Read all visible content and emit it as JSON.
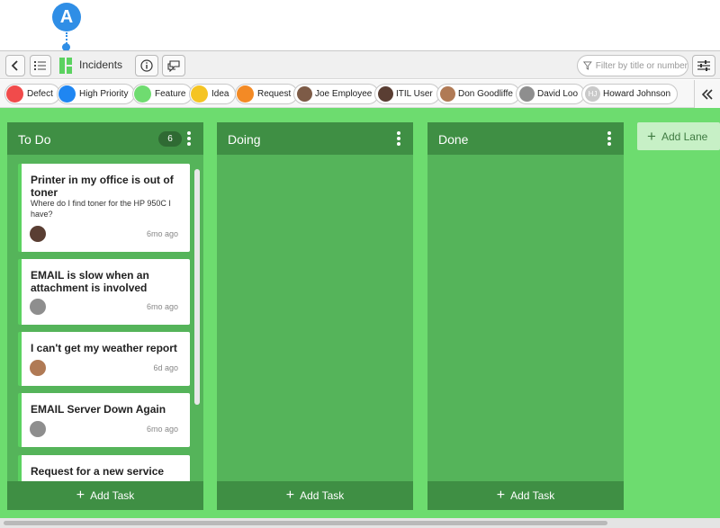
{
  "callout": {
    "label": "A"
  },
  "toolbar": {
    "title": "Incidents",
    "filter_placeholder": "Filter by title or number"
  },
  "tags": [
    {
      "label": "Defect",
      "color": "#f14b4b"
    },
    {
      "label": "High Priority",
      "color": "#1f86f2"
    },
    {
      "label": "Feature",
      "color": "#6fdc70"
    },
    {
      "label": "Idea",
      "color": "#f5c423"
    },
    {
      "label": "Request",
      "color": "#f38a25"
    }
  ],
  "people": [
    {
      "label": "Joe Employee"
    },
    {
      "label": "ITIL User"
    },
    {
      "label": "Don Goodliffe"
    },
    {
      "label": "David Loo"
    },
    {
      "label": "Howard Johnson",
      "initials": "HJ"
    }
  ],
  "lanes": [
    {
      "title": "To Do",
      "count": "6",
      "add_task": "Add Task",
      "cards": [
        {
          "title": "Printer in my office is out of toner",
          "desc": "Where do I find toner for the HP 950C I have?",
          "time": "6mo ago"
        },
        {
          "title": "EMAIL is slow when an attachment is involved",
          "desc": "",
          "time": "6mo ago"
        },
        {
          "title": "I can't get my weather report",
          "desc": "",
          "time": "6d ago"
        },
        {
          "title": "EMAIL Server Down Again",
          "desc": "",
          "time": "6mo ago"
        },
        {
          "title": "Request for a new service",
          "desc": "",
          "time": ""
        }
      ]
    },
    {
      "title": "Doing",
      "add_task": "Add Task",
      "cards": []
    },
    {
      "title": "Done",
      "add_task": "Add Task",
      "cards": []
    }
  ],
  "add_lane_label": "Add Lane",
  "colors": {
    "board_bg": "#6ddc6f",
    "lane_bg": "#55b45a",
    "lane_header": "#3f8f44",
    "accent": "#2f8ee6"
  }
}
